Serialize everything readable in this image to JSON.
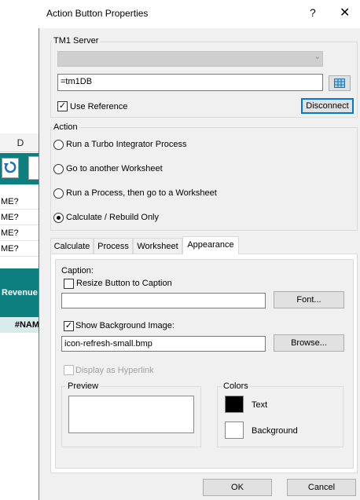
{
  "sheet": {
    "column_header": "D",
    "rows": [
      "ME?",
      "ME?",
      "ME?",
      "ME?"
    ],
    "revenue_label": "Revenue",
    "nam_label": "#NAM"
  },
  "dialog": {
    "title": "Action Button Properties",
    "help": "?",
    "close": "✕"
  },
  "tm1_server": {
    "legend": "TM1 Server",
    "server_combo_value": "",
    "reference_value": "=tm1DB",
    "use_reference_label": "Use Reference",
    "use_reference_checked": "✓",
    "disconnect_label": "Disconnect"
  },
  "action": {
    "legend": "Action",
    "options": [
      "Run a Turbo Integrator Process",
      "Go to another Worksheet",
      "Run a Process, then go to a Worksheet",
      "Calculate / Rebuild Only"
    ],
    "selected": "Calculate / Rebuild Only"
  },
  "tabs": [
    "Calculate",
    "Process",
    "Worksheet",
    "Appearance"
  ],
  "active_tab": "Appearance",
  "appearance": {
    "caption_label": "Caption:",
    "resize_label": "Resize Button to Caption",
    "caption_value": "",
    "font_button": "Font...",
    "show_bg_label": "Show Background Image:",
    "show_bg_checked": "✓",
    "bg_image_value": "icon-refresh-small.bmp",
    "browse_button": "Browse...",
    "hyperlink_label": "Display as Hyperlink",
    "preview_legend": "Preview",
    "colors_legend": "Colors",
    "text_color_label": "Text",
    "text_color": "#000000",
    "background_color_label": "Background",
    "background_color": "#ffffff"
  },
  "footer": {
    "ok": "OK",
    "cancel": "Cancel"
  }
}
